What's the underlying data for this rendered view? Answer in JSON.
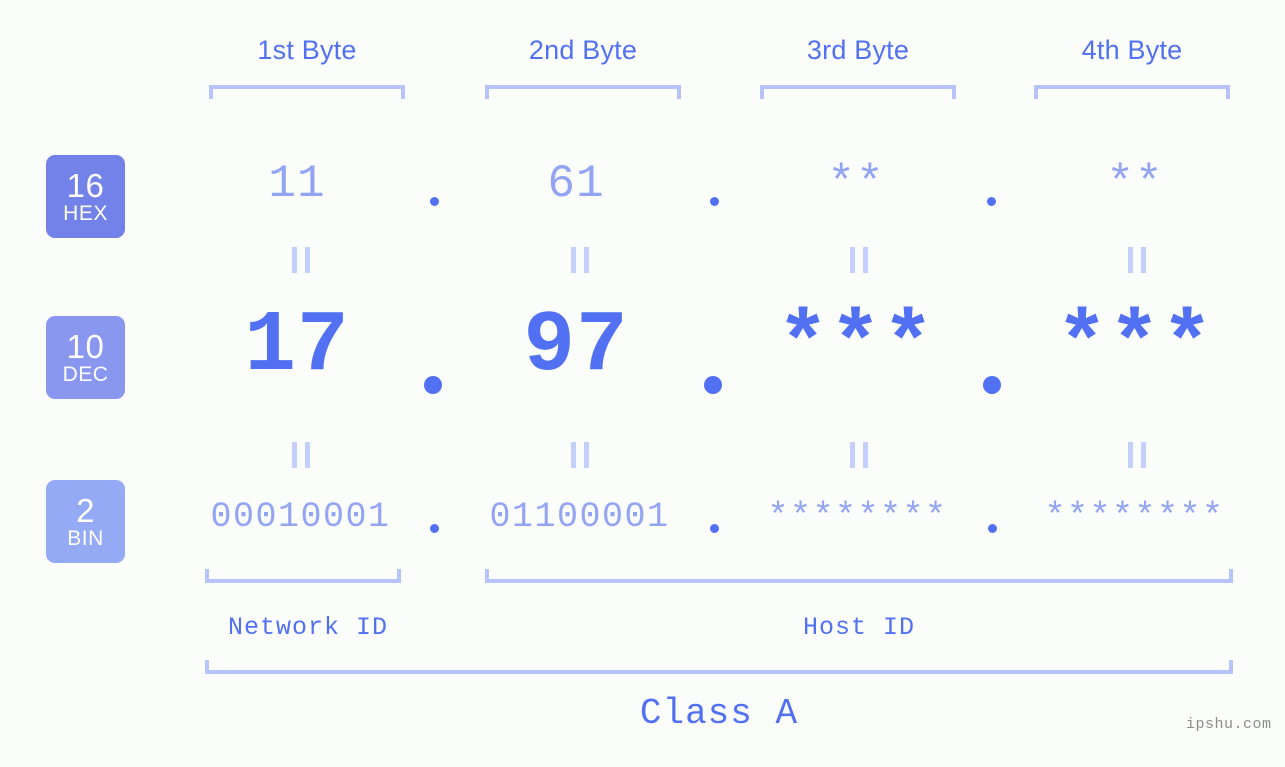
{
  "background": "#fbfdfa",
  "accent": "#5271f2",
  "accent_light": "#93a4f3",
  "bracket_color": "#b8c2fb",
  "headers": [
    {
      "label": "1st Byte"
    },
    {
      "label": "2nd Byte"
    },
    {
      "label": "3rd Byte"
    },
    {
      "label": "4th Byte"
    }
  ],
  "radix_badges": [
    {
      "number": "16",
      "name": "HEX",
      "color": "#7282e8"
    },
    {
      "number": "10",
      "name": "DEC",
      "color": "#8a97ef"
    },
    {
      "number": "2",
      "name": "BIN",
      "color": "#94aaf5"
    }
  ],
  "rows": {
    "hex": {
      "octets": [
        "11",
        "61",
        "**",
        "**"
      ]
    },
    "dec": {
      "octets": [
        "17",
        "97",
        "***",
        "***"
      ]
    },
    "bin": {
      "octets": [
        "00010001",
        "01100001",
        "********",
        "********"
      ]
    }
  },
  "separator": ".",
  "equality_mark": "=",
  "footer": {
    "network_id_label": "Network ID",
    "host_id_label": "Host ID",
    "class_label": "Class A",
    "watermark": "ipshu.com"
  }
}
